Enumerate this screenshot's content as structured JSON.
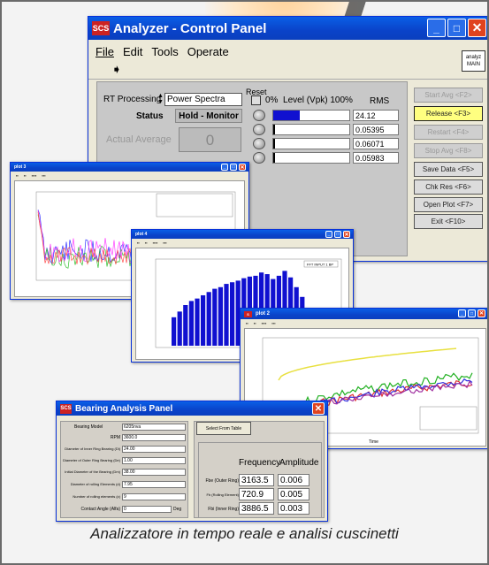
{
  "caption": "Analizzatore in tempo reale e analisi cuscinetti",
  "colors": {
    "titlebar": "#0a48d1",
    "close": "#e0431f",
    "release": "#ffff80",
    "bars": "#1010d0"
  },
  "control_panel": {
    "logo": "SCS",
    "title": "Analyzer - Control Panel",
    "menu": [
      "File",
      "Edit",
      "Tools",
      "Operate"
    ],
    "run_icon": "run-arrow-icon",
    "badge_line1": "analyz",
    "badge_line2": "MAIN",
    "rt_label": "RT Processing",
    "rt_value": "Power Spectra",
    "status_label": "Status",
    "status_value": "Hold - Monitor",
    "actual_average_label": "Actual Average",
    "actual_average_value": "0",
    "reset_label": "Reset",
    "level_label": "0%  Level (Vpk) 100%",
    "rms_label": "RMS",
    "rms_values": [
      "24.12",
      "0.05395",
      "0.06071",
      "0.05983"
    ],
    "levels": [
      0.35,
      0.02,
      0.02,
      0.02
    ],
    "buttons": [
      "Start Avg <F2>",
      "Release <F3>",
      "Restart <F4>",
      "Stop Avg <F8>",
      "Save Data <F5>",
      "Chk Res <F6>",
      "Open Plot <F7>",
      "Exit <F10>"
    ]
  },
  "plot3": {
    "title": "plot 3"
  },
  "plot4": {
    "title": "plot 4",
    "legend": "FFT INPUT 1 BP"
  },
  "plot2": {
    "title": "plot 2",
    "xlabel": "Time"
  },
  "bearing": {
    "logo": "SCS",
    "title": "Bearing Analysis Panel",
    "fields": [
      {
        "label": "Bearing Model",
        "value": "6205nva"
      },
      {
        "label": "RPM",
        "value": "3600.0"
      },
      {
        "label": "Diameter of Inner Ring Bearing (Di)",
        "value": "24.00"
      },
      {
        "label": "Diameter of Outer Ring Bearing (De)",
        "value": "1.00"
      },
      {
        "label": "Initial Diameter of the Bearing (Dm)",
        "value": "38.00"
      },
      {
        "label": "Diameter of rolling Elements (d)",
        "value": "7.95"
      },
      {
        "label": "Number of rolling elements (z)",
        "value": "9"
      },
      {
        "label": "Contact Angle (Alfa)",
        "value": "0"
      }
    ],
    "deg": "Deg",
    "select_button": "Select From Table",
    "freq_header": "Frequency",
    "amp_header": "Amplitude",
    "rows": [
      {
        "label": "Fbe (Outer Ring)",
        "freq": "3163.5",
        "amp": "0.006"
      },
      {
        "label": "Fb (Rolling Element)",
        "freq": "720.9",
        "amp": "0.005"
      },
      {
        "label": "Fbi (Inner Ring)",
        "freq": "3886.5",
        "amp": "0.003"
      }
    ]
  }
}
